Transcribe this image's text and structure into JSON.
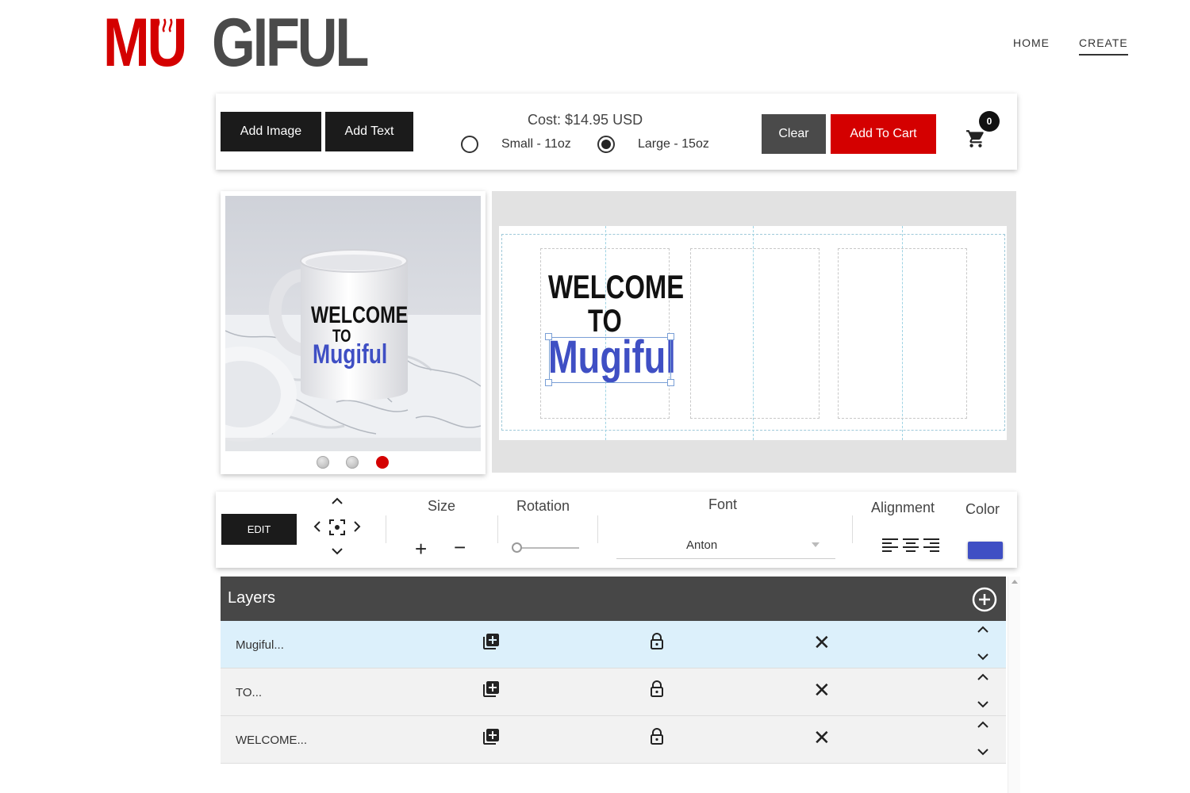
{
  "brand": {
    "logo_part1": "MU",
    "logo_part2": "GIFUL",
    "red": "#d40000",
    "gray": "#4a4a4a"
  },
  "nav": {
    "home": "HOME",
    "create": "CREATE"
  },
  "toolbar": {
    "add_image": "Add Image",
    "add_text": "Add Text",
    "cost": "Cost: $14.95 USD",
    "sizes": [
      {
        "label": "Small - 11oz",
        "selected": false
      },
      {
        "label": "Large - 15oz",
        "selected": true
      }
    ],
    "clear": "Clear",
    "add_to_cart": "Add To Cart",
    "cart_count": "0",
    "cart_icon": "cart-icon"
  },
  "preview": {
    "mug_text": [
      "WELCOME",
      "TO",
      "Mugiful"
    ],
    "dots": [
      {
        "color": "#c4c4c4",
        "active": false
      },
      {
        "color": "#c4c4c4",
        "active": false
      },
      {
        "color": "#d40000",
        "active": true
      }
    ]
  },
  "design": {
    "lines": [
      {
        "text": "WELCOME",
        "color": "#111111"
      },
      {
        "text": "TO",
        "color": "#111111"
      },
      {
        "text": "Mugiful",
        "color": "#3f4fc4"
      }
    ]
  },
  "editbar": {
    "edit": "EDIT",
    "size_label": "Size",
    "rotation_label": "Rotation",
    "rotation_value": 0,
    "font_label": "Font",
    "font_value": "Anton",
    "alignment_label": "Alignment",
    "color_label": "Color",
    "color_value": "#3f4fc4"
  },
  "layers": {
    "title": "Layers",
    "items": [
      {
        "name": "Mugiful...",
        "selected": true
      },
      {
        "name": "TO...",
        "selected": false
      },
      {
        "name": "WELCOME...",
        "selected": false
      }
    ],
    "row_selected_bg": "#dcf0fb",
    "row_bg": "#f2f2f2"
  }
}
